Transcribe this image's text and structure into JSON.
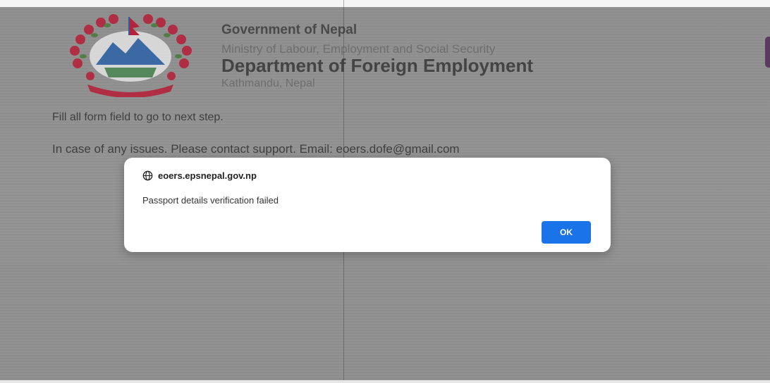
{
  "header": {
    "government": "Government of Nepal",
    "ministry": "Ministry of Labour, Employment and Social Security",
    "department": "Department of Foreign Employment",
    "location": "Kathmandu, Nepal"
  },
  "page": {
    "instruction": "Fill all form field to go to next step.",
    "support": "In case of any issues. Please contact support. Email: eoers.dofe@gmail.com"
  },
  "dialog": {
    "origin": "eoers.epsnepal.gov.np",
    "message": "Passport details verification failed",
    "ok_label": "OK"
  },
  "colors": {
    "overlay": "#909090",
    "dialog_bg": "#ffffff",
    "ok_button": "#1a73e8",
    "emblem_red": "#b3243b",
    "emblem_blue": "#2a5d9f"
  },
  "icons": {
    "emblem": "nepal-emblem-icon",
    "origin": "globe-icon"
  }
}
